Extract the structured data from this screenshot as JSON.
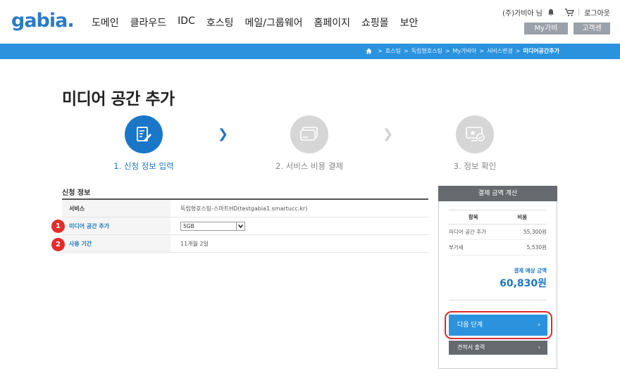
{
  "header": {
    "logo": "gabia",
    "logo_dot": ".",
    "nav": [
      "도메인",
      "클라우드",
      "IDC",
      "호스팅",
      "메일/그룹웨어",
      "홈페이지",
      "쇼핑몰",
      "보안"
    ],
    "user": "(주)가비아",
    "user_suffix": "님",
    "logout": "로그아웃",
    "my_gabia": "My가비아",
    "customer_center": "고객센터"
  },
  "breadcrumb": {
    "items": [
      "호스팅",
      "독립형호스팅",
      "My가비아",
      "서비스변경"
    ],
    "current": "미디어공간추가"
  },
  "page": {
    "title": "미디어 공간 추가"
  },
  "steps": [
    {
      "label": "1. 신청 정보 입력",
      "state": "active"
    },
    {
      "label": "2. 서비스 비용 결제",
      "state": "inactive"
    },
    {
      "label": "3. 정보 확인",
      "state": "inactive"
    }
  ],
  "form": {
    "section": "신청 정보",
    "rows": [
      {
        "label": "서비스",
        "value": "독립형호스팅-스마트HD(testgabia1.smartucc.kr)"
      },
      {
        "label": "미디어 공간 추가",
        "value": "5GB"
      },
      {
        "label": "사용 기간",
        "value": "11개월 2일"
      }
    ],
    "badges": [
      "1",
      "2"
    ]
  },
  "summary": {
    "title": "결제 금액 계산",
    "col_item": "항목",
    "col_cost": "비용",
    "rows": [
      {
        "item": "미디어 공간 추가",
        "cost": "55,300원"
      },
      {
        "item": "부가세",
        "cost": "5,530원"
      }
    ],
    "est_label": "결제 예상 금액",
    "est_value": "60,830원",
    "next_label": "다음 단계",
    "quote_label": "견적서 출력"
  },
  "colors": {
    "brand_blue": "#2b93de",
    "active_step": "#1a77c8",
    "highlight_red": "#e0282e"
  }
}
